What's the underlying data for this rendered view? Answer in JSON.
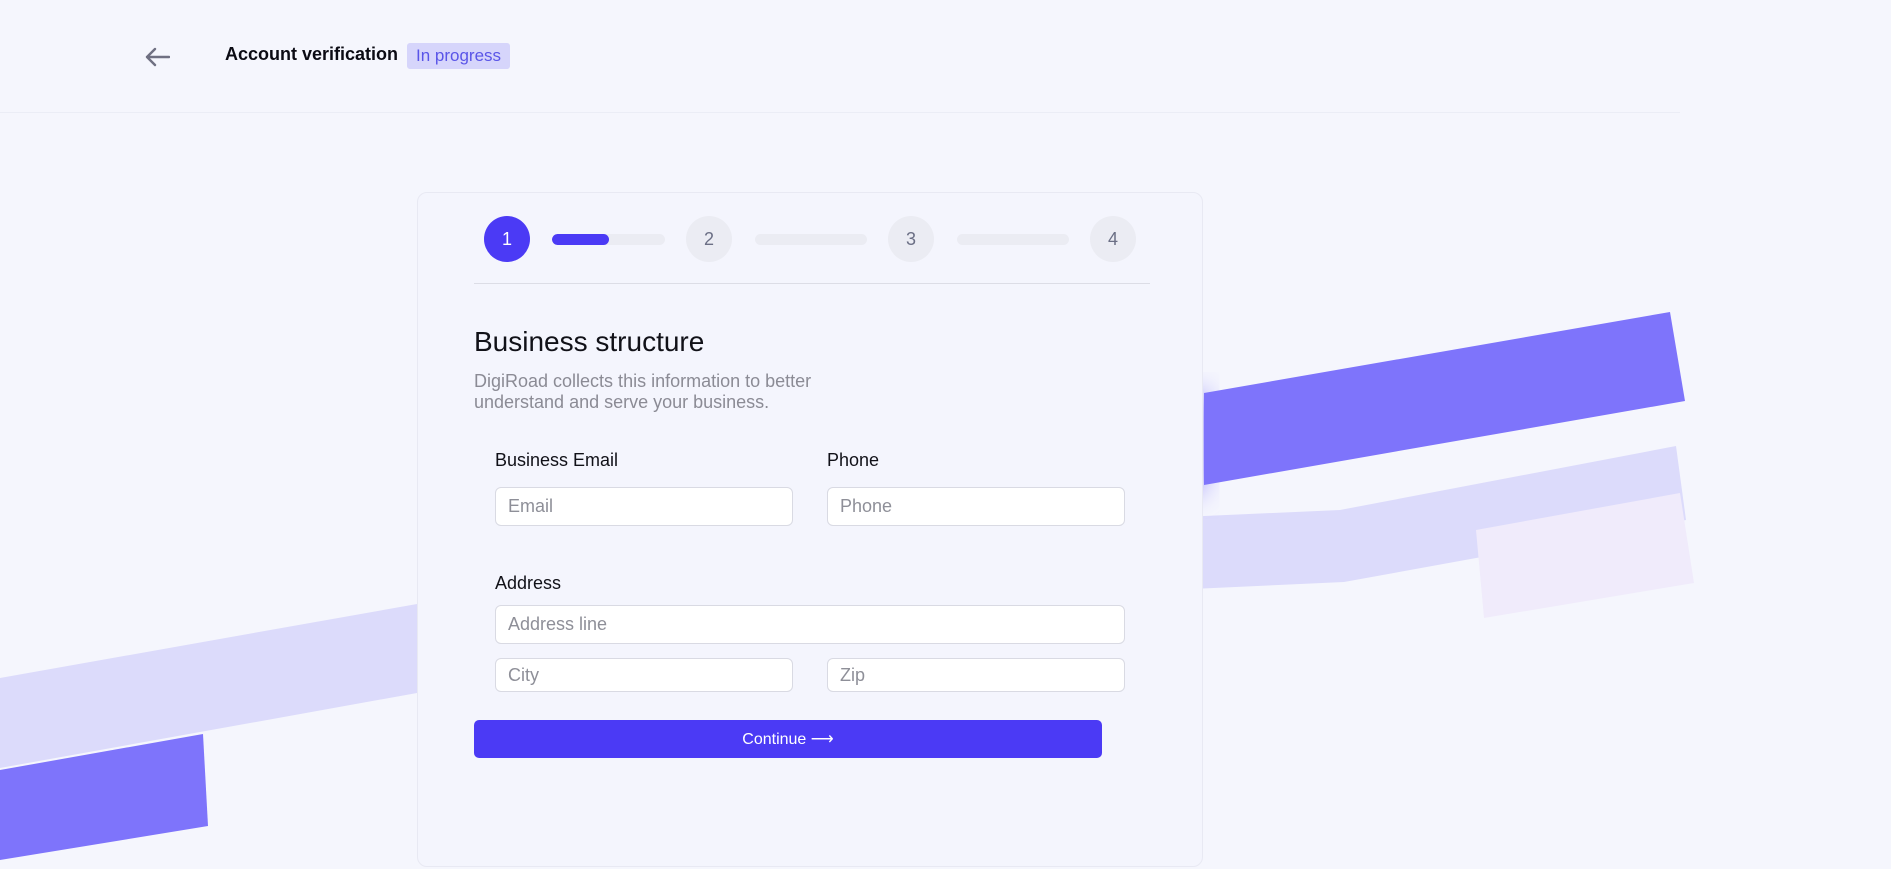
{
  "header": {
    "back_icon": "arrow-left-icon",
    "title": "Account verification",
    "status_badge": "In progress"
  },
  "stepper": {
    "steps": [
      "1",
      "2",
      "3",
      "4"
    ],
    "current_step": 1,
    "progress": [
      0.5,
      0,
      0
    ]
  },
  "form": {
    "title": "Business structure",
    "description": "DigiRoad collects this information to better understand and serve your business.",
    "email_label": "Business Email",
    "email_placeholder": "Email",
    "phone_label": "Phone",
    "phone_placeholder": "Phone",
    "address_label": "Address",
    "address_placeholder": "Address line",
    "city_placeholder": "City",
    "zip_placeholder": "Zip",
    "continue_label": "Continue ⟶"
  },
  "colors": {
    "accent": "#4b3af5",
    "badge_bg": "#d6d5fb",
    "badge_text": "#5a55e8",
    "page_bg": "#f5f6fd"
  }
}
